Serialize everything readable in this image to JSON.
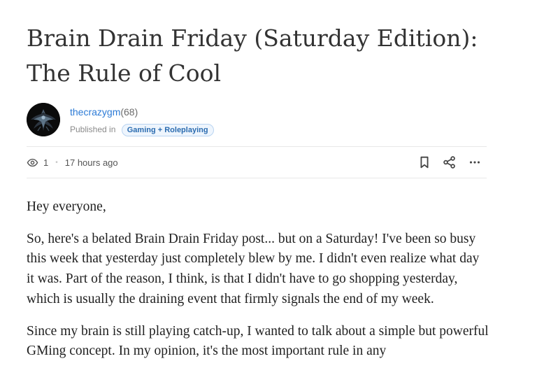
{
  "post": {
    "title": "Brain Drain Friday (Saturday Edition): The Rule of Cool"
  },
  "author": {
    "name": "thecrazygm",
    "reputation": "(68)",
    "avatar_icon": "dark-angel-avatar"
  },
  "community": {
    "published_in_label": "Published in",
    "name": "Gaming + Roleplaying"
  },
  "meta": {
    "views": "1",
    "time_ago": "17 hours ago",
    "icons": [
      "eye-icon",
      "bookmark-icon",
      "share-icon",
      "more-icon"
    ]
  },
  "body": {
    "paragraphs": [
      "Hey everyone,",
      "So, here's a belated Brain Drain Friday post... but on a Saturday! I've been so busy this week that yesterday just completely blew by me. I didn't even realize what day it was. Part of the reason, I think, is that I didn't have to go shopping yesterday, which is usually the draining event that firmly signals the end of my week.",
      "Since my brain is still playing catch-up, I wanted to talk about a simple but powerful GMing concept. In my opinion, it's the most important rule in any"
    ]
  },
  "colors": {
    "title": "#333333",
    "link": "#2b7ad6",
    "badge_text": "#2b6cb0",
    "badge_bg": "#eef5fd",
    "divider": "#e8e8e8"
  }
}
